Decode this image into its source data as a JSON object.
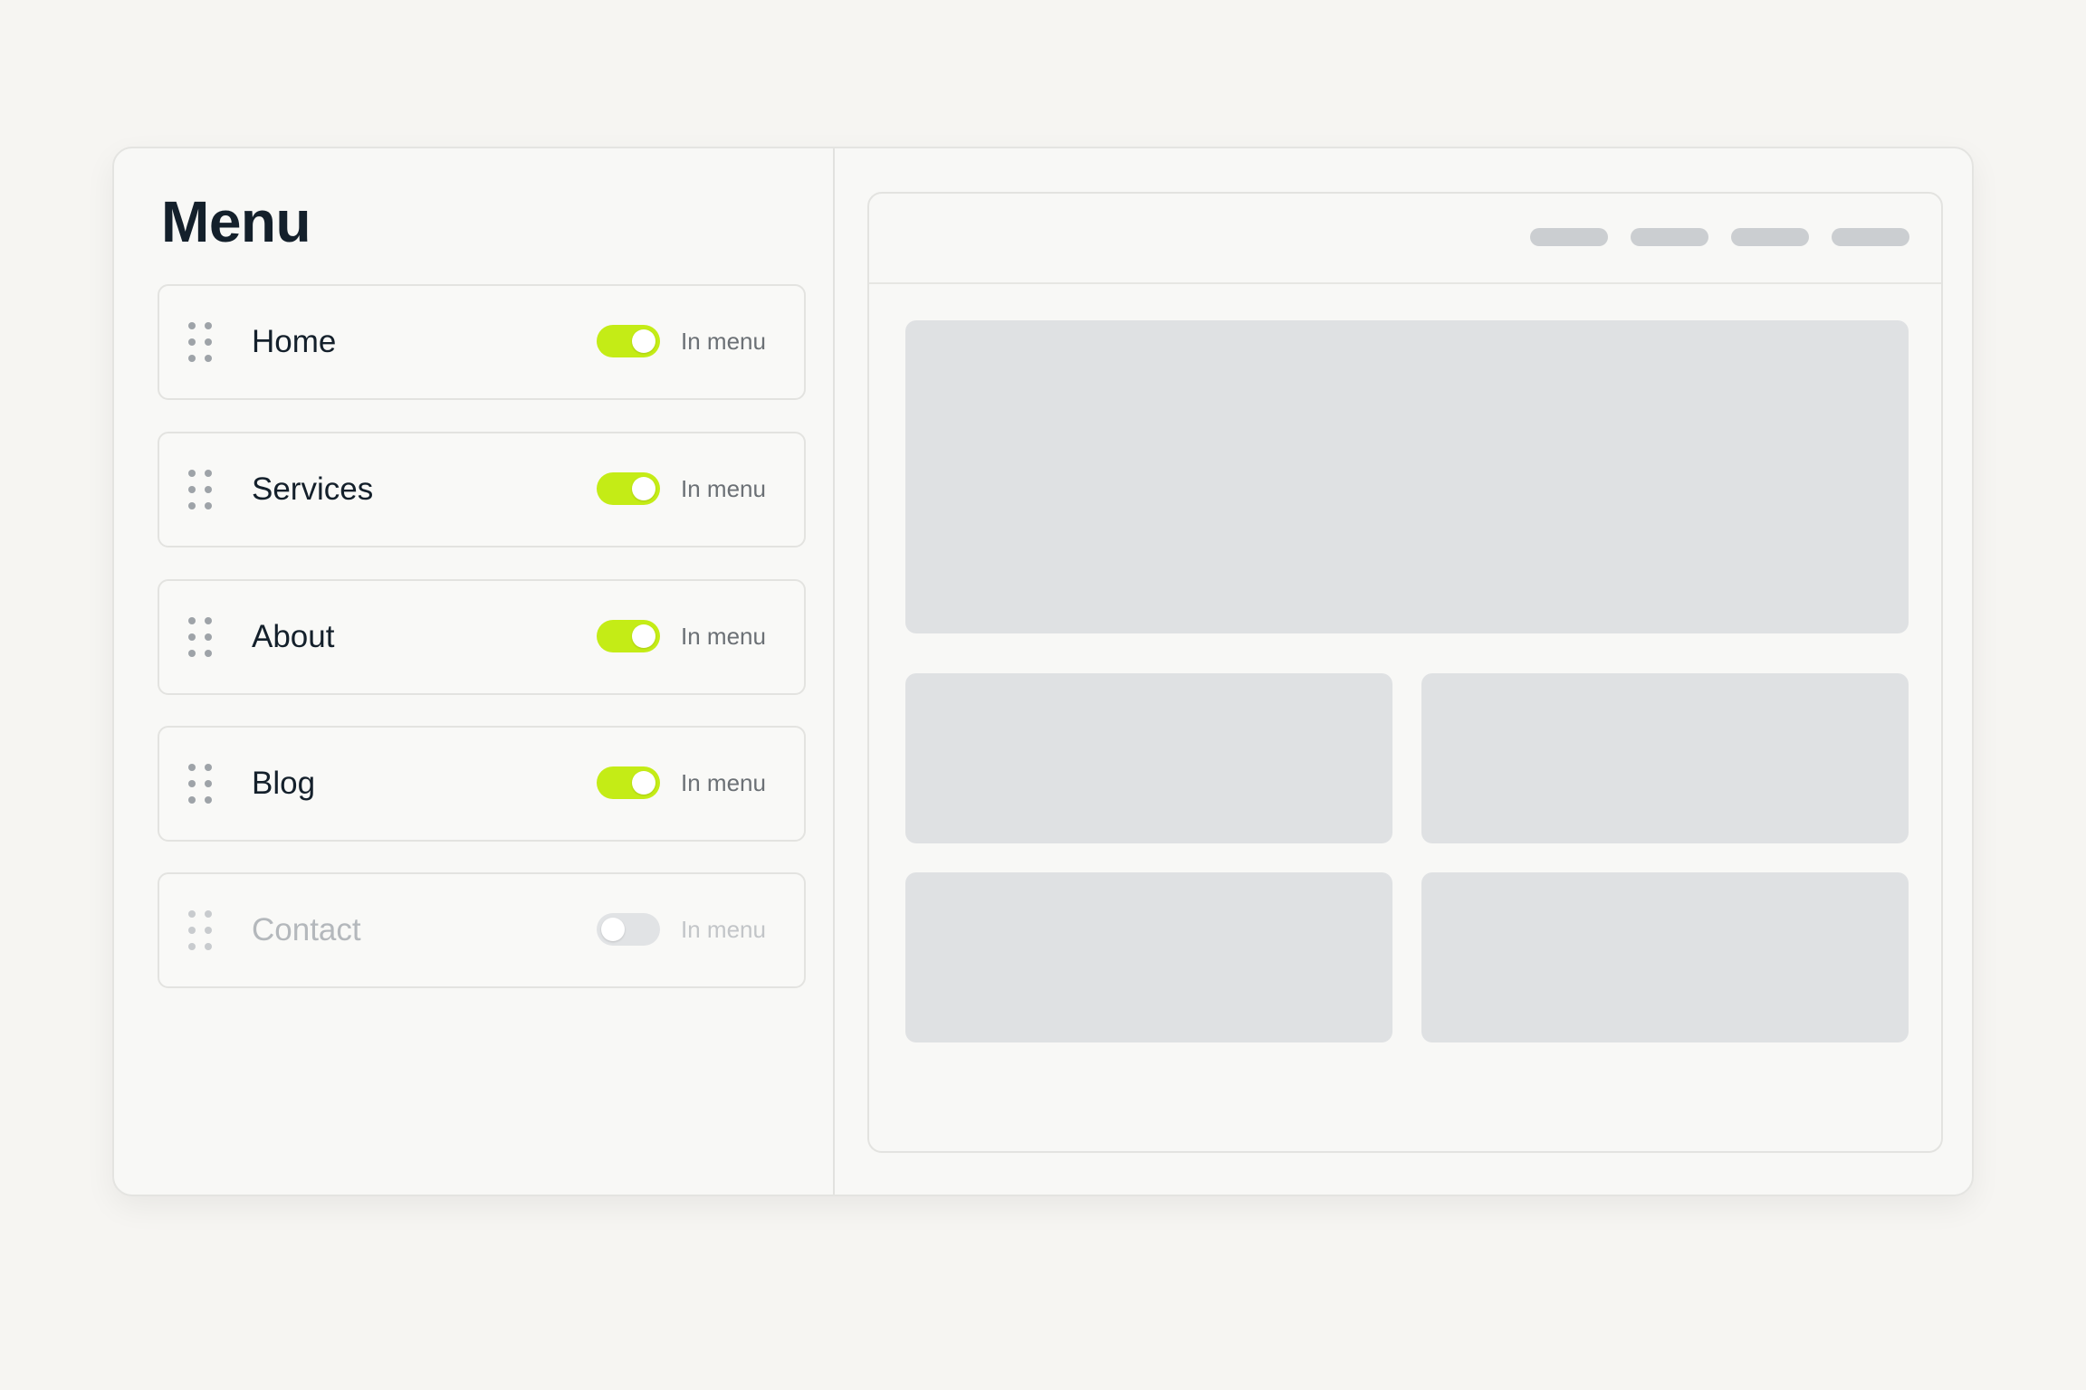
{
  "sidebar": {
    "title": "Menu",
    "items": [
      {
        "label": "Home",
        "status": "In menu",
        "enabled": true
      },
      {
        "label": "Services",
        "status": "In menu",
        "enabled": true
      },
      {
        "label": "About",
        "status": "In menu",
        "enabled": true
      },
      {
        "label": "Blog",
        "status": "In menu",
        "enabled": true
      },
      {
        "label": "Contact",
        "status": "In menu",
        "enabled": false
      }
    ]
  },
  "colors": {
    "accent": "#c4ec16",
    "background": "#f6f5f2",
    "placeholder": "#dfe1e3",
    "text": "#14202b"
  },
  "icons": {
    "drag": "drag-handle-icon"
  }
}
